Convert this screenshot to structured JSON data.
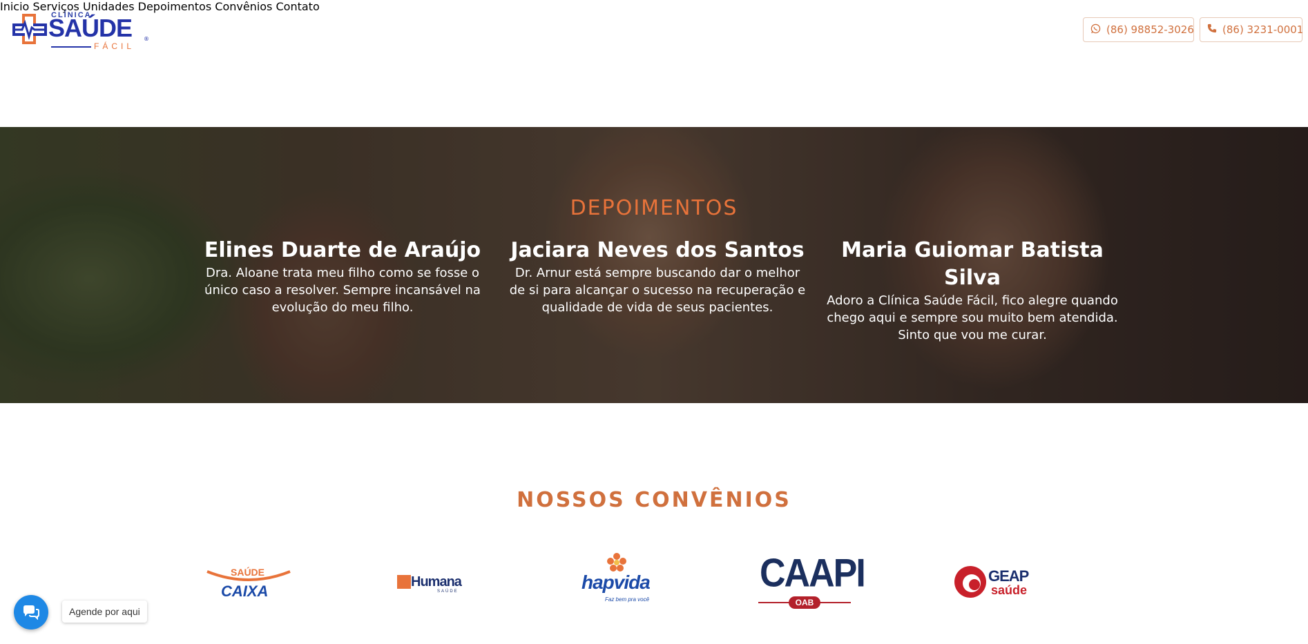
{
  "brand": {
    "small": "CLÍNICA",
    "main": "SAÚDE",
    "sub": "FÁCIL",
    "reg": "®",
    "colors": {
      "blue": "#2433a8",
      "orange": "#e8733a"
    }
  },
  "nav": {
    "items": [
      {
        "label": "Inicio"
      },
      {
        "label": "Serviços"
      },
      {
        "label": "Unidades"
      },
      {
        "label": "Depoimentos"
      },
      {
        "label": "Convênios"
      },
      {
        "label": "Contato"
      }
    ],
    "whatsapp": {
      "icon": "whatsapp-icon",
      "label": "(86) 98852-3026"
    },
    "phone": {
      "icon": "phone-icon",
      "label": "(86) 3231-0001"
    }
  },
  "testimonials": {
    "title": "DEPOIMENTOS",
    "items": [
      {
        "name": "Elines Duarte de Araújo",
        "text": "Dra. Aloane trata meu filho como se fosse o único caso a resolver. Sempre incansável na evolução do meu filho."
      },
      {
        "name": "Jaciara Neves dos Santos",
        "text": "Dr. Arnur está sempre buscando dar o melhor de si para alcançar o sucesso na recuperação e qualidade de vida de seus pacientes."
      },
      {
        "name": "Maria Guiomar Batista Silva",
        "text": "Adoro a Clínica Saúde Fácil, fico alegre quando chego aqui e sempre sou muito bem atendida. Sinto que vou me curar."
      }
    ]
  },
  "convenios": {
    "title": "NOSSOS CONVÊNIOS",
    "partners": [
      {
        "top": "SAÚDE",
        "bottom": "CAIXA"
      },
      {
        "top": "Humana",
        "bottom": "SAÚDE"
      },
      {
        "top": "hapvida",
        "bottom": "Faz bem pra você"
      },
      {
        "top": "CAAPI",
        "bottom": "OAB"
      },
      {
        "top": "GEAP",
        "bottom": "saúde"
      }
    ]
  },
  "chat": {
    "icon": "chat-icon",
    "label": "Agende por aqui"
  },
  "colors": {
    "accent": "#d0703d",
    "chat": "#1e88e5"
  }
}
